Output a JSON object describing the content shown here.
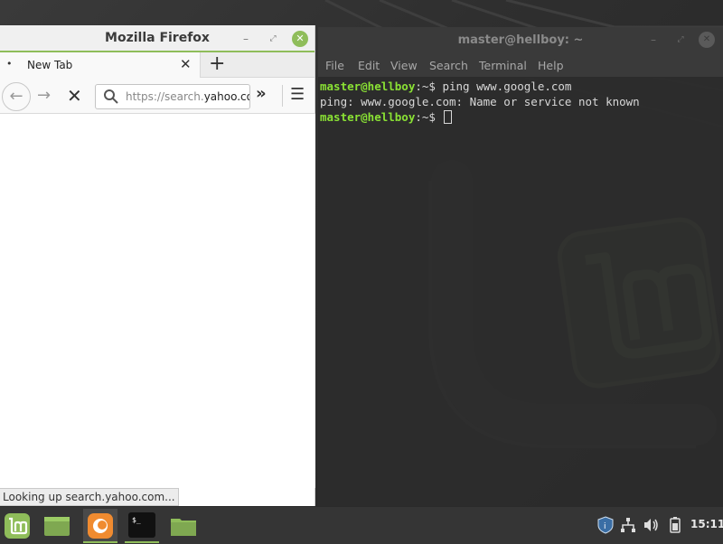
{
  "desktop": {
    "wallpaper": "linux-mint-logo",
    "accent_color": "#8fbd5a"
  },
  "firefox": {
    "window_title": "Mozilla Firefox",
    "tab": {
      "label": "New Tab",
      "indicator": "•"
    },
    "newtab_glyph": "+",
    "url": {
      "dim_prefix": "https://search.",
      "domain": "yahoo.com"
    },
    "status_text": "Looking up search.yahoo.com...",
    "icons": [
      "back-arrow-icon",
      "forward-arrow-icon",
      "stop-icon",
      "search-icon",
      "overflow-icon",
      "hamburger-menu-icon"
    ]
  },
  "terminal": {
    "window_title": "master@hellboy: ~",
    "menu": [
      "File",
      "Edit",
      "View",
      "Search",
      "Terminal",
      "Help"
    ],
    "prompt_user": "master@hellboy",
    "prompt_path": ":~$ ",
    "lines": {
      "command": "ping www.google.com",
      "output": "ping: www.google.com: Name or service not known"
    }
  },
  "taskbar": {
    "items": [
      "mint-menu-icon",
      "show-desktop-icon",
      "firefox-icon",
      "terminal-icon",
      "files-icon"
    ],
    "tray": [
      "shield-icon",
      "network-icon",
      "volume-icon",
      "battery-icon"
    ],
    "clock": "15:11"
  }
}
